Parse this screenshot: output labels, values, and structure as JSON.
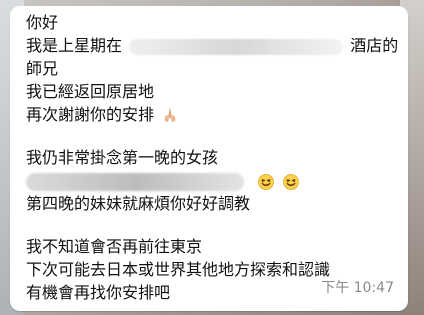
{
  "message": {
    "lines": [
      "你好",
      "我是上星期在",
      "酒店的",
      "師兄",
      "我已經返回原居地",
      "再次謝謝你的安排",
      "我仍非常掛念第一晚的女孩",
      "第四晚的妹妹就麻煩你好好調教",
      "我不知道會否再前往東京",
      "下次可能去日本或世界其他地方探索和認識",
      "有機會再找你安排吧"
    ],
    "time": "下午 10:47"
  },
  "icons": {
    "pray": "folded-hands-icon",
    "laughing": "laughing-face-icon"
  }
}
